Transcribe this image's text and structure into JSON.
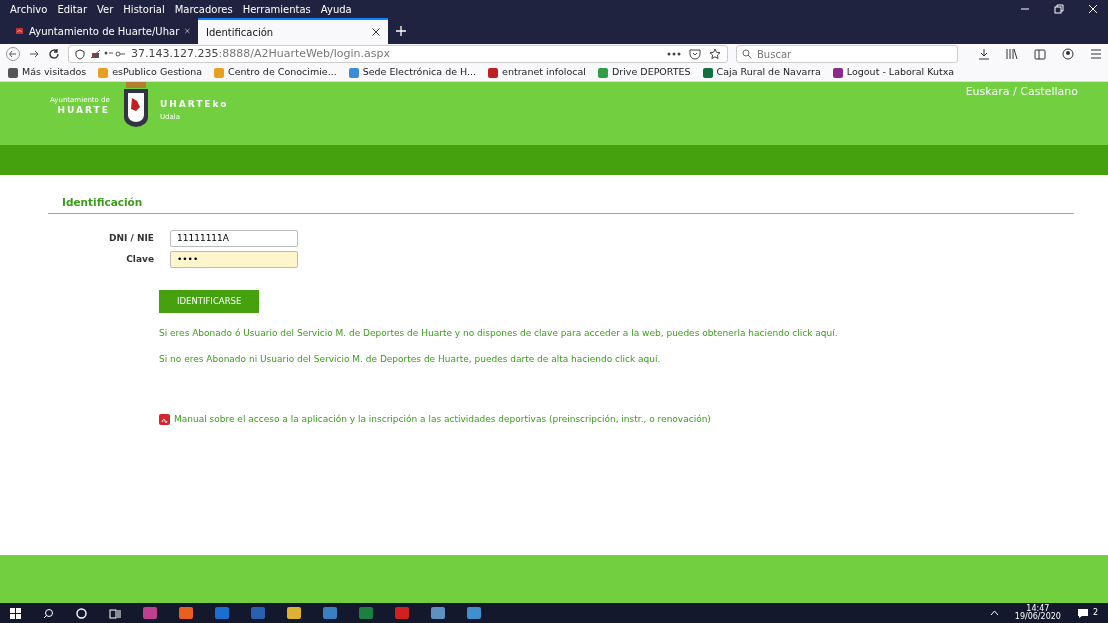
{
  "menu_bar": [
    "Archivo",
    "Editar",
    "Ver",
    "Historial",
    "Marcadores",
    "Herramientas",
    "Ayuda"
  ],
  "tabs": [
    {
      "label": "Ayuntamiento de Huarte/Uhar",
      "selected": false
    },
    {
      "label": "Identificación",
      "selected": true
    }
  ],
  "address": {
    "host": "37.143.127.235",
    "rest": ":8888/A2HuarteWeb/login.aspx"
  },
  "search": {
    "placeholder": "Buscar"
  },
  "bookmarks": [
    {
      "label": "Más visitados",
      "color": "#555555"
    },
    {
      "label": "esPublico Gestiona",
      "color": "#e8a020"
    },
    {
      "label": "Centro de Conocimie...",
      "color": "#e8a020"
    },
    {
      "label": "Sede Electrónica de H...",
      "color": "#3a8ed8"
    },
    {
      "label": "entranet infolocal",
      "color": "#c02020"
    },
    {
      "label": "Drive DEPORTES",
      "color": "#2f9e44"
    },
    {
      "label": "Caja Rural de Navarra",
      "color": "#107040"
    },
    {
      "label": "Logout - Laboral Kutxa",
      "color": "#8a2a8a"
    }
  ],
  "header": {
    "org_line1": "Ayuntamiento de",
    "org_line2": "HUARTE",
    "basque_line1": "UHARTEko",
    "basque_line2": "Udala",
    "languages": "Euskara / Castellano"
  },
  "login": {
    "title": "Identificación",
    "fields": [
      {
        "label": "DNI / NIE",
        "value": "11111111A",
        "kind": "text"
      },
      {
        "label": "Clave",
        "value": "••••",
        "kind": "password"
      }
    ],
    "button": "IDENTIFICARSE",
    "notes": [
      "Si eres Abonado ó Usuario del Servicio M. de Deportes de Huarte y no dispones de clave para acceder a la web, puedes obtenerla haciendo click aquí.",
      "Si no eres Abonado ni Usuario del Servicio M. de Deportes de Huarte, puedes darte de alta haciendo click aquí."
    ],
    "manual_link": "Manual sobre el acceso a la aplicación y la inscripción a las actividades deportivas (preinscripción, instr., o renovación)"
  },
  "taskbar": {
    "time": "14:47",
    "date": "19/06/2020",
    "notifications": "2"
  }
}
